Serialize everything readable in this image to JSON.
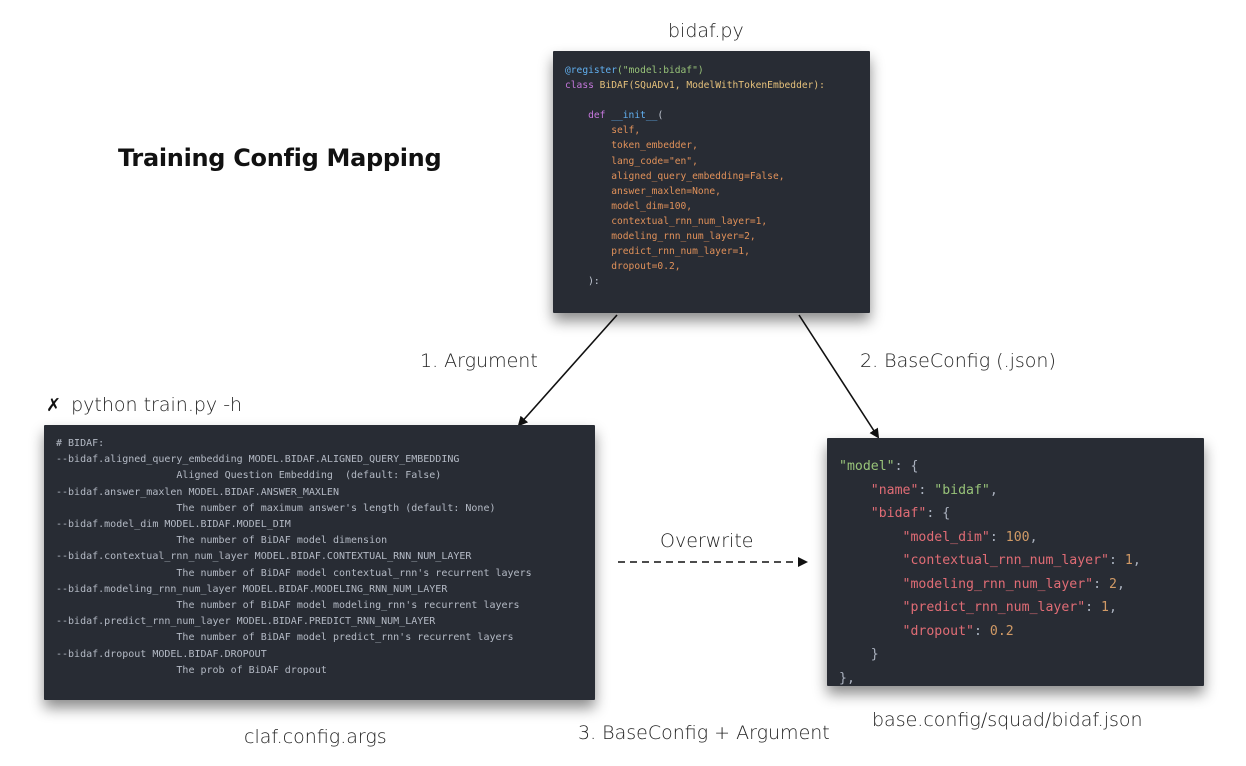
{
  "title": "Training Config Mapping",
  "captions": {
    "py_file": "bidaf.py",
    "arg_edge": "1. Argument",
    "base_edge": "2. BaseConfig (.json)",
    "cli_cmd": "python train.py -h",
    "cli_mark": "✗",
    "overwrite": "Overwrite",
    "args_module": "claf.config.args",
    "merge_edge": "3. BaseConfig + Argument",
    "json_file": "base.config/squad/bidaf.json"
  },
  "py_code": {
    "decorator": "@register",
    "decorator_arg": "(\"model:bidaf\")",
    "class_kw": "class",
    "class_name": "BiDAF",
    "class_bases": "(SQuADv1, ModelWithTokenEmbedder):",
    "def_kw": "def",
    "init": "__init__",
    "open_paren": "(",
    "params": [
      "self,",
      "token_embedder,",
      "lang_code=\"en\",",
      "aligned_query_embedding=False,",
      "answer_maxlen=None,",
      "model_dim=100,",
      "contextual_rnn_num_layer=1,",
      "modeling_rnn_num_layer=2,",
      "predict_rnn_num_layer=1,",
      "dropout=0.2,"
    ],
    "close": "):"
  },
  "args_lines": [
    "# BIDAF:",
    "--bidaf.aligned_query_embedding MODEL.BIDAF.ALIGNED_QUERY_EMBEDDING",
    "                    Aligned Question Embedding  (default: False)",
    "--bidaf.answer_maxlen MODEL.BIDAF.ANSWER_MAXLEN",
    "                    The number of maximum answer's length (default: None)",
    "--bidaf.model_dim MODEL.BIDAF.MODEL_DIM",
    "                    The number of BiDAF model dimension",
    "--bidaf.contextual_rnn_num_layer MODEL.BIDAF.CONTEXTUAL_RNN_NUM_LAYER",
    "                    The number of BiDAF model contextual_rnn's recurrent layers",
    "--bidaf.modeling_rnn_num_layer MODEL.BIDAF.MODELING_RNN_NUM_LAYER",
    "                    The number of BiDAF model modeling_rnn's recurrent layers",
    "--bidaf.predict_rnn_num_layer MODEL.BIDAF.PREDICT_RNN_NUM_LAYER",
    "                    The number of BiDAF model predict_rnn's recurrent layers",
    "--bidaf.dropout MODEL.BIDAF.DROPOUT",
    "                    The prob of BiDAF dropout"
  ],
  "json_code": {
    "model_key": "\"model\"",
    "name_key": "\"name\"",
    "name_val": "\"bidaf\"",
    "bidaf_key": "\"bidaf\"",
    "entries": [
      {
        "key": "\"model_dim\"",
        "val": "100",
        "sep": ","
      },
      {
        "key": "\"contextual_rnn_num_layer\"",
        "val": "1",
        "sep": ","
      },
      {
        "key": "\"modeling_rnn_num_layer\"",
        "val": "2",
        "sep": ","
      },
      {
        "key": "\"predict_rnn_num_layer\"",
        "val": "1",
        "sep": ","
      },
      {
        "key": "\"dropout\"",
        "val": "0.2",
        "sep": ""
      }
    ]
  }
}
